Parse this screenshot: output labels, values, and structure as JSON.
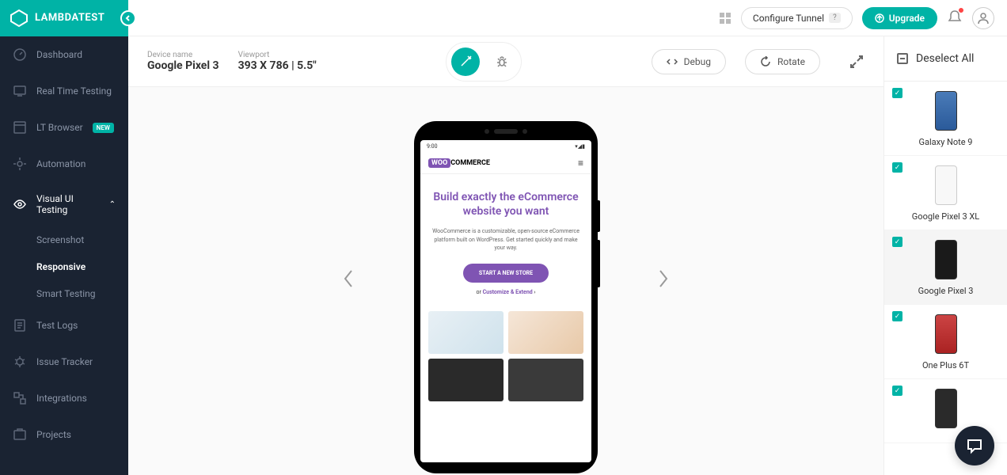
{
  "brand": "LAMBDATEST",
  "header": {
    "configure_tunnel": "Configure Tunnel",
    "help": "?",
    "upgrade": "Upgrade"
  },
  "sidebar": {
    "items": [
      {
        "label": "Dashboard"
      },
      {
        "label": "Real Time Testing"
      },
      {
        "label": "LT Browser",
        "badge": "NEW"
      },
      {
        "label": "Automation"
      },
      {
        "label": "Visual UI Testing"
      },
      {
        "label": "Test Logs"
      },
      {
        "label": "Issue Tracker"
      },
      {
        "label": "Integrations"
      },
      {
        "label": "Projects"
      }
    ],
    "submenu": [
      {
        "label": "Screenshot"
      },
      {
        "label": "Responsive"
      },
      {
        "label": "Smart Testing"
      }
    ]
  },
  "canvas": {
    "device_name_label": "Device name",
    "device_name": "Google Pixel 3",
    "viewport_label": "Viewport",
    "viewport": "393 X 786 | 5.5\"",
    "debug": "Debug",
    "rotate": "Rotate"
  },
  "mock": {
    "time": "9:00",
    "logo_woo": "WOO",
    "logo_commerce": "COMMERCE",
    "title": "Build exactly the eCommerce website you want",
    "desc": "WooCommerce is a customizable, open-source eCommerce platform built on WordPress. Get started quickly and make your way.",
    "cta": "START A NEW STORE",
    "sub_or": "or ",
    "sub_link": "Customize & Extend",
    "sub_arrow": " ›"
  },
  "panel": {
    "deselect": "Deselect All",
    "devices": [
      {
        "name": "Galaxy Note 9"
      },
      {
        "name": "Google Pixel 3 XL"
      },
      {
        "name": "Google Pixel 3"
      },
      {
        "name": "One Plus 6T"
      },
      {
        "name": ""
      }
    ]
  }
}
